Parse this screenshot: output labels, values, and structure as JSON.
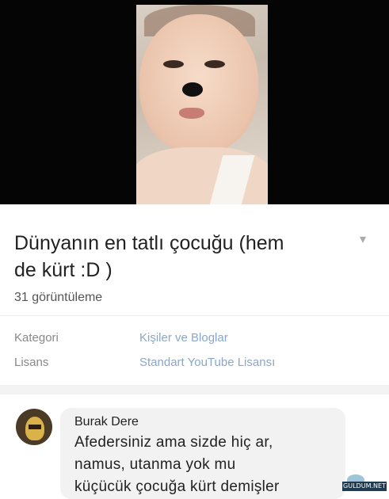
{
  "video": {
    "thumbnail_icon": "baby-with-dog-filter"
  },
  "details": {
    "title_line1": "Dünyanın en tatlı çocuğu (hem",
    "title_line2": "de kürt :D )",
    "expand_icon": "chevron-down-icon",
    "views": "31 görüntüleme",
    "meta": [
      {
        "label": "Kategori",
        "value": "Kişiler ve Bloglar"
      },
      {
        "label": "Lisans",
        "value": "Standart YouTube Lisansı"
      }
    ],
    "link_color": "#8aa7c8"
  },
  "comment": {
    "author": "Burak Dere",
    "lines": [
      "Afedersiniz ama sizde hiç ar,",
      "namus, utanma yok mu",
      "küçücük çocuğa kürt demişler"
    ]
  },
  "watermark": {
    "text": "GULDUM.NET"
  }
}
